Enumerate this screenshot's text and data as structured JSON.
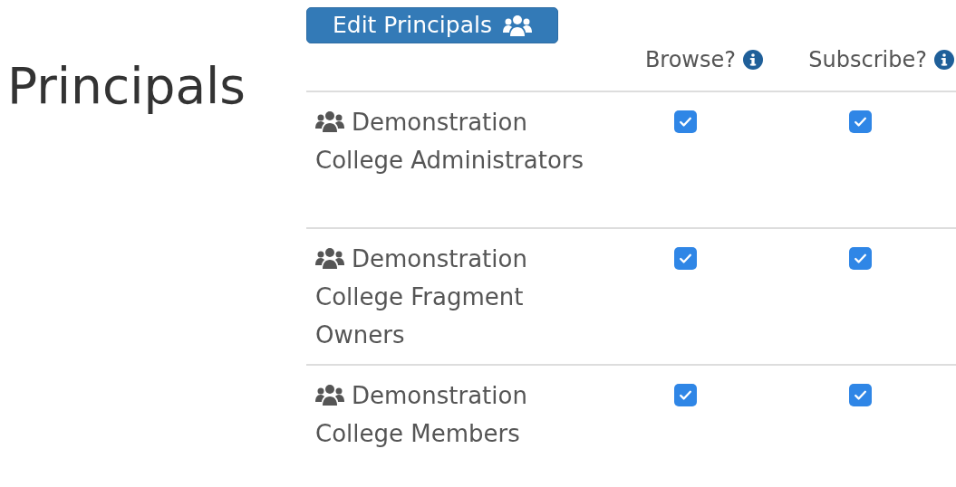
{
  "heading": "Principals",
  "edit_button": {
    "label": "Edit Principals"
  },
  "table": {
    "columns": [
      {
        "label": "Browse?"
      },
      {
        "label": "Subscribe?"
      }
    ],
    "rows": [
      {
        "name": "Demonstration College Administrators",
        "checks": [
          {
            "checked": true
          },
          {
            "checked": true
          }
        ]
      },
      {
        "name": "Demonstration College Fragment Owners",
        "checks": [
          {
            "checked": true
          },
          {
            "checked": true
          }
        ]
      },
      {
        "name": "Demonstration College Members",
        "checks": [
          {
            "checked": true
          },
          {
            "checked": true
          }
        ]
      }
    ]
  }
}
